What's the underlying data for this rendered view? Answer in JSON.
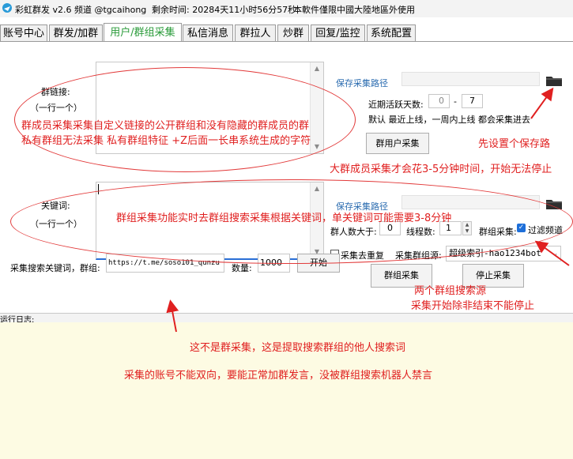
{
  "window": {
    "app_name": "彩虹群发 v2.6 频道 @tgcaihong",
    "remaining": "剩余时间: 20284天11小时56分57秒",
    "notice": "本軟件僅限中國大陸地區外使用"
  },
  "tabs": [
    {
      "label": "账号中心"
    },
    {
      "label": "群发/加群"
    },
    {
      "label": "用户/群组采集"
    },
    {
      "label": "私信消息"
    },
    {
      "label": "群拉人"
    },
    {
      "label": "炒群"
    },
    {
      "label": "回复/监控"
    },
    {
      "label": "系统配置"
    }
  ],
  "section1": {
    "label_links": "群链接:",
    "label_per_line": "（一行一个）",
    "save_path_label": "保存采集路径",
    "active_days_label": "近期活跃天数:",
    "active_from": "0",
    "active_sep": "-",
    "active_to": "7",
    "default_note": "默认 最近上线，一周内上线 都会采集进去",
    "collect_users_button": "群用户采集"
  },
  "section2": {
    "label_keywords": "关键词:",
    "label_per_line": "（一行一个）",
    "save_path_label": "保存采集路径",
    "member_gt_label": "群人数大于:",
    "member_gt_value": "0",
    "threads_label": "线程数:",
    "threads_value": "1",
    "group_collect_label": "群组采集:",
    "filter_channel_label": "过滤频道",
    "filter_channel_checked": true,
    "dedupe_label": "采集去重复",
    "dedupe_checked": false,
    "source_label": "采集群组源:",
    "source_value": "超级索引-hao1234bot",
    "group_collect_button": "群组采集",
    "stop_collect_button": "停止采集"
  },
  "search_row": {
    "label": "采集搜索关键词，群组:",
    "group_value": "https://t.me/soso101_qunzu",
    "count_label": "数量:",
    "count_value": "1000",
    "start_button": "开始"
  },
  "log": {
    "label": "运行日志:"
  },
  "annotations": {
    "a1_line1": "群成员采集采集自定义链接的公开群组和没有隐藏的群成员的群",
    "a1_line2": "私有群组无法采集 私有群组特征 +Z后面一长串系统生成的字符",
    "a2": "先设置个保存路",
    "a3": "大群成员采集才会花3-5分钟时间，开始无法停止",
    "a4": "群组采集功能实时去群组搜索采集根据关键词，单关键词可能需要3-8分钟",
    "a5_line1": "两个群组搜索源",
    "a5_line2": "采集开始除非结束不能停止",
    "a6": "这不是群采集，这是提取搜索群组的他人搜索词",
    "a7": "采集的账号不能双向，要能正常加群发言，没被群组搜索机器人禁言"
  },
  "colors": {
    "accent_green": "#2a9b3a",
    "annotation_red": "#e02020",
    "label_blue": "#2b6cb0",
    "log_bg": "#fdfbe3"
  }
}
